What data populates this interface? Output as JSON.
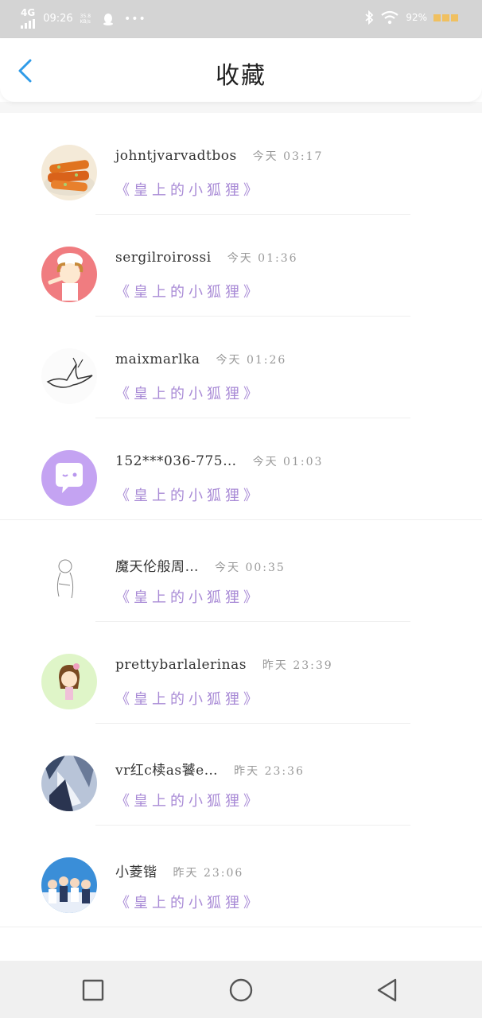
{
  "status_bar": {
    "network": "4G",
    "time": "09:26",
    "speed": "35.8\nKB/s",
    "dots": "•••",
    "battery": "92%"
  },
  "header": {
    "title": "收藏"
  },
  "favorites": [
    {
      "name": "johntjvarvadtbos",
      "time": "今天 03:17",
      "book": "《皇上的小狐狸》"
    },
    {
      "name": "sergilroirossi",
      "time": "今天 01:36",
      "book": "《皇上的小狐狸》"
    },
    {
      "name": "maixmarlka",
      "time": "今天 01:26",
      "book": "《皇上的小狐狸》"
    },
    {
      "name": "152***036-775…",
      "time": "今天 01:03",
      "book": "《皇上的小狐狸》"
    },
    {
      "name": "魔天伦般周…",
      "time": "今天 00:35",
      "book": "《皇上的小狐狸》"
    },
    {
      "name": "prettybarlalerinas",
      "time": "昨天 23:39",
      "book": "《皇上的小狐狸》"
    },
    {
      "name": "vr红c椟as饕e…",
      "time": "昨天 23:36",
      "book": "《皇上的小狐狸》"
    },
    {
      "name": "小菱锴",
      "time": "昨天 23:06",
      "book": "《皇上的小狐狸》"
    }
  ],
  "colors": {
    "accent_blue": "#2f9be8",
    "book_purple": "#a98bd6",
    "status_bar_bg": "#d4d4d4"
  },
  "nav": {
    "recent_icon": "square-icon",
    "home_icon": "circle-icon",
    "back_icon": "triangle-back-icon"
  }
}
